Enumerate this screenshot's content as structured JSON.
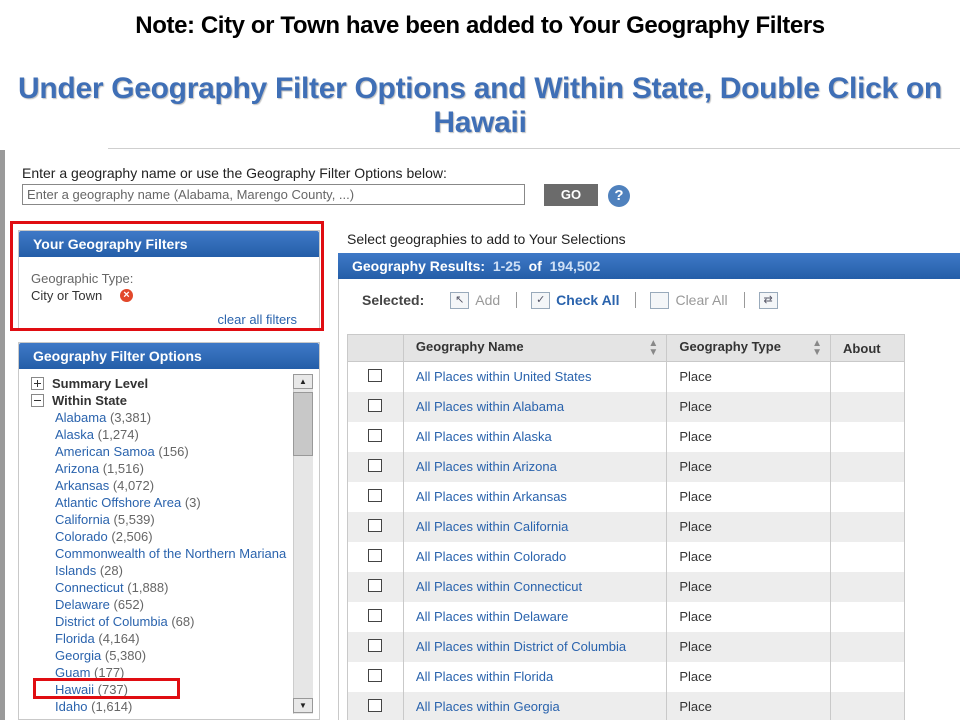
{
  "slide": {
    "note": "Note: City or Town have been added to Your Geography Filters",
    "instruction": "Under Geography Filter Options and Within State, Double Click on Hawaii"
  },
  "search": {
    "prompt": "Enter a geography name or use the Geography Filter Options below:",
    "placeholder": "Enter a geography name (Alabama, Marengo County, ...)",
    "go_label": "GO",
    "help_symbol": "?"
  },
  "filters_panel": {
    "title": "Your Geography Filters",
    "type_label": "Geographic Type:",
    "type_value": "City or Town",
    "remove_symbol": "×",
    "clear_all": "clear all filters"
  },
  "options_panel": {
    "title": "Geography Filter Options",
    "summary_level": "Summary Level",
    "within_state": "Within State",
    "states": [
      {
        "name": "Alabama",
        "count": "(3,381)"
      },
      {
        "name": "Alaska",
        "count": "(1,274)"
      },
      {
        "name": "American Samoa",
        "count": "(156)"
      },
      {
        "name": "Arizona",
        "count": "(1,516)"
      },
      {
        "name": "Arkansas",
        "count": "(4,072)"
      },
      {
        "name": "Atlantic Offshore Area",
        "count": "(3)"
      },
      {
        "name": "California",
        "count": "(5,539)"
      },
      {
        "name": "Colorado",
        "count": "(2,506)"
      },
      {
        "name": "Commonwealth of the Northern Mariana Islands",
        "count": "(28)"
      },
      {
        "name": "Connecticut",
        "count": "(1,888)"
      },
      {
        "name": "Delaware",
        "count": "(652)"
      },
      {
        "name": "District of Columbia",
        "count": "(68)"
      },
      {
        "name": "Florida",
        "count": "(4,164)"
      },
      {
        "name": "Georgia",
        "count": "(5,380)"
      },
      {
        "name": "Guam",
        "count": "(177)"
      },
      {
        "name": "Hawaii",
        "count": "(737)"
      },
      {
        "name": "Idaho",
        "count": "(1,614)"
      }
    ]
  },
  "results": {
    "heading": "Select geographies to add to Your Selections",
    "bar_label": "Geography Results:",
    "range": "1-25",
    "of_label": "of",
    "total": "194,502",
    "toolbar": {
      "selected": "Selected:",
      "add": "Add",
      "check_all": "Check All",
      "clear_all": "Clear All"
    },
    "columns": {
      "name": "Geography Name",
      "type": "Geography Type",
      "about": "About"
    },
    "rows": [
      {
        "name": "All Places within United States",
        "type": "Place"
      },
      {
        "name": "All Places within Alabama",
        "type": "Place"
      },
      {
        "name": "All Places within Alaska",
        "type": "Place"
      },
      {
        "name": "All Places within Arizona",
        "type": "Place"
      },
      {
        "name": "All Places within Arkansas",
        "type": "Place"
      },
      {
        "name": "All Places within California",
        "type": "Place"
      },
      {
        "name": "All Places within Colorado",
        "type": "Place"
      },
      {
        "name": "All Places within Connecticut",
        "type": "Place"
      },
      {
        "name": "All Places within Delaware",
        "type": "Place"
      },
      {
        "name": "All Places within District of Columbia",
        "type": "Place"
      },
      {
        "name": "All Places within Florida",
        "type": "Place"
      },
      {
        "name": "All Places within Georgia",
        "type": "Place"
      }
    ]
  },
  "colors": {
    "header_blue": "#2b64ad",
    "link_blue": "#2a63ad",
    "highlight_red": "#e00d12",
    "instruction_blue": "#3f6fb6"
  }
}
